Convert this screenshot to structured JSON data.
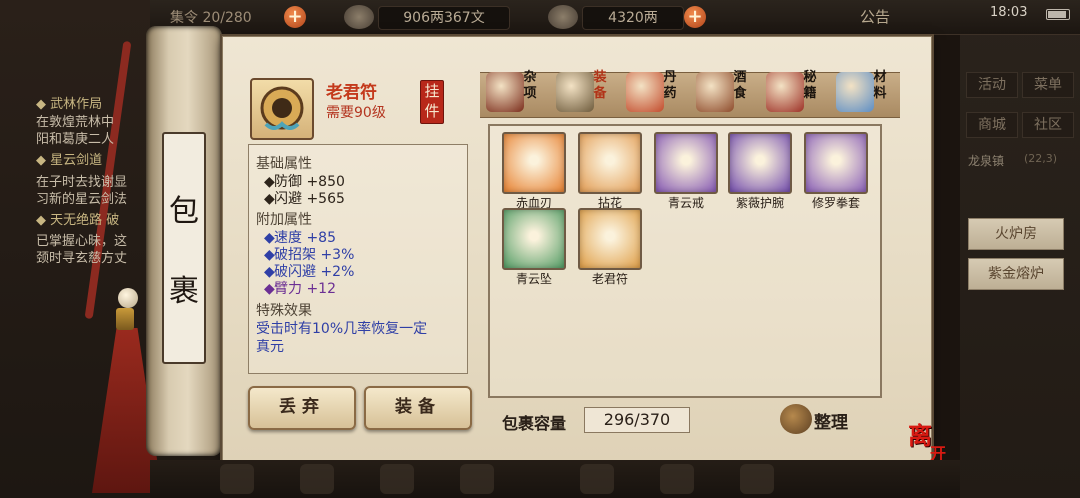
{
  "top_bar": {
    "partial_label": "集令 20/280",
    "silver_display": "906两367文",
    "gold_display": "4320两",
    "notice_label": "公告",
    "clock": "18:03",
    "plus_symbol": "+"
  },
  "quest_log": [
    {
      "text": "◆ 武林作局",
      "type": "head"
    },
    {
      "text": "在敦煌荒林中",
      "type": "body"
    },
    {
      "text": "阳和葛庚二人",
      "type": "body"
    },
    {
      "text": "◆ 星云剑道",
      "type": "head"
    },
    {
      "text": "在子时去找谢显",
      "type": "body"
    },
    {
      "text": "习新的星云剑法",
      "type": "body"
    },
    {
      "text": "◆ 天无绝路 破",
      "type": "head"
    },
    {
      "text": "已掌握心昧，这",
      "type": "body"
    },
    {
      "text": "颈时寻玄慈方丈",
      "type": "body"
    }
  ],
  "right_menu": {
    "activity": "活动",
    "menu": "菜单",
    "shop": "商城",
    "community": "社区",
    "location": "龙泉镇",
    "location_num": "(22,3)",
    "fire_room": "火炉房",
    "forge": "紫金熔炉"
  },
  "scroll_title": [
    "包",
    "裹"
  ],
  "selected_item": {
    "name": "老君符",
    "requirement": "需要90级",
    "badge": "挂件"
  },
  "categories": [
    {
      "label": "杂项",
      "active": false,
      "color": "#7a2b1a"
    },
    {
      "label": "装备",
      "active": true,
      "color": "#6d5a3b"
    },
    {
      "label": "丹药",
      "active": false,
      "color": "#c24a2b"
    },
    {
      "label": "酒食",
      "active": false,
      "color": "#8d4a2a"
    },
    {
      "label": "秘籍",
      "active": false,
      "color": "#9c2f25"
    },
    {
      "label": "材料",
      "active": false,
      "color": "#5c8dc4"
    }
  ],
  "stats": {
    "base_title": "基础属性",
    "base": [
      "防御  +850",
      "闪避  +565"
    ],
    "extra_title": "附加属性",
    "extra": [
      "速度  +85",
      "破招架  +3%",
      "破闪避  +2%",
      "臂力  +12"
    ],
    "special_title": "特殊效果",
    "special_desc_1": "受击时有10%几率恢复一定",
    "special_desc_2": "真元"
  },
  "buttons": {
    "discard": "丢弃",
    "equip": "装备"
  },
  "inventory": [
    {
      "name": "赤血刃",
      "color": "#e8873a"
    },
    {
      "name": "拈花",
      "color": "#e3a05a"
    },
    {
      "name": "青云戒",
      "color": "#8a5fb5"
    },
    {
      "name": "紫薇护腕",
      "color": "#7a55b0"
    },
    {
      "name": "修罗拳套",
      "color": "#8e65b8"
    },
    {
      "name": "青云坠",
      "color": "#5aa06a"
    },
    {
      "name": "老君符",
      "color": "#e0a24e"
    }
  ],
  "check_mark": "✔",
  "capacity": {
    "label": "包裹容量",
    "value": "296/370"
  },
  "sort_label": "整理",
  "leave_label": "离",
  "leave_label_2": "开"
}
